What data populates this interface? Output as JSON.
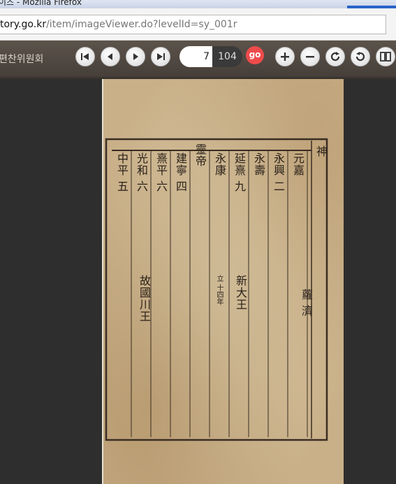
{
  "browser": {
    "window_title": "이즈 - Mozilla Firefox",
    "url_prefix": "tory.go.kr",
    "url_rest": "/item/imageViewer.do?levelId=sy_001r"
  },
  "viewer": {
    "org_name": "편찬위원회",
    "current_page": "7",
    "total_pages": "104",
    "go_label": "go"
  },
  "icons": {
    "first": "first-page-icon",
    "prev": "previous-page-icon",
    "next": "next-page-icon",
    "last": "last-page-icon",
    "zoom_in": "zoom-in-icon",
    "zoom_out": "zoom-out-icon",
    "rotate_cw": "rotate-clockwise-icon",
    "rotate_ccw": "rotate-counterclockwise-icon",
    "dual": "dual-page-icon"
  },
  "colors": {
    "go": "#ee4b4b",
    "toolbar": "#4f4741",
    "paper": "#d4bf98"
  },
  "document": {
    "columns": [
      {
        "text": "神",
        "size": "big"
      },
      {
        "text": "元嘉",
        "size": "big"
      },
      {
        "text": "永興 二",
        "size": "big"
      },
      {
        "text": "永壽",
        "size": "big"
      },
      {
        "text": "延熹 九",
        "size": "big"
      },
      {
        "text": "永康",
        "size": "big"
      },
      {
        "text": "靈帝",
        "size": "big"
      },
      {
        "text": "建寧 四",
        "size": "big"
      },
      {
        "text": "熹平 六",
        "size": "big"
      },
      {
        "text": "光和 六",
        "size": "big"
      },
      {
        "text": "中平 五",
        "size": "big"
      },
      {
        "text": "蘿 濟",
        "size": "big"
      },
      {
        "text": "立 十四年",
        "size": "small"
      },
      {
        "text": "新大王",
        "size": "small"
      },
      {
        "text": "故國川王",
        "size": "small"
      }
    ]
  }
}
